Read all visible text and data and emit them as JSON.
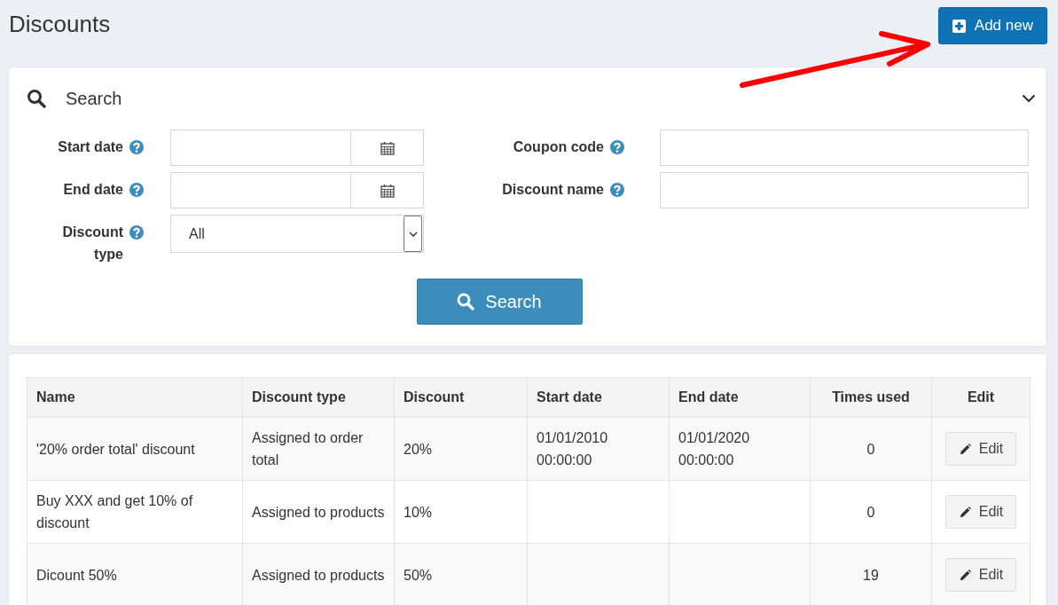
{
  "page_title": "Discounts",
  "add_button": {
    "label": "Add new"
  },
  "search_panel": {
    "title": "Search",
    "left_fields": [
      {
        "label": "Start date",
        "kind": "date"
      },
      {
        "label": "End date",
        "kind": "date"
      },
      {
        "label": "Discount type",
        "kind": "select",
        "value": "All"
      }
    ],
    "right_fields": [
      {
        "label": "Coupon code",
        "kind": "text"
      },
      {
        "label": "Discount name",
        "kind": "text"
      }
    ],
    "search_button": "Search"
  },
  "table": {
    "columns": [
      "Name",
      "Discount type",
      "Discount",
      "Start date",
      "End date",
      "Times used",
      "Edit"
    ],
    "rows": [
      {
        "cells": [
          "'20% order total' discount",
          "Assigned to order total",
          "20%",
          "01/01/2010 00:00:00",
          "01/01/2020 00:00:00",
          "0"
        ],
        "edit": "Edit"
      },
      {
        "cells": [
          "Buy XXX and get 10% of discount",
          "Assigned to products",
          "10%",
          "",
          "",
          "0"
        ],
        "edit": "Edit"
      },
      {
        "cells": [
          "Dicount 50%",
          "Assigned to products",
          "50%",
          "",
          "",
          "19"
        ],
        "edit": "Edit"
      }
    ]
  }
}
